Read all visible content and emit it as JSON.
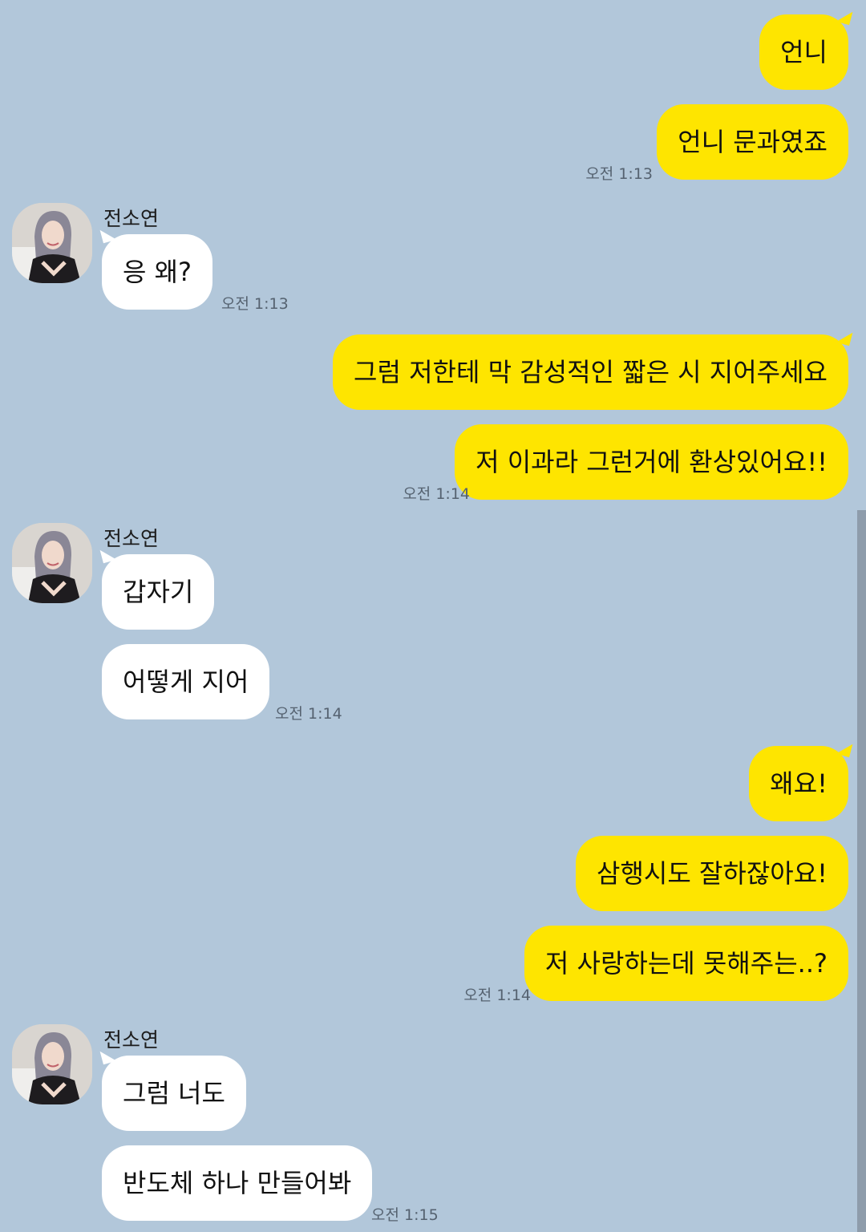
{
  "theme": {
    "background": "#b2c7da",
    "my_bubble": "#fee500",
    "their_bubble": "#ffffff"
  },
  "contact": {
    "name": "전소연",
    "avatar_icon": "profile-photo"
  },
  "groups": [
    {
      "sender": "me",
      "messages": [
        "언니",
        "언니 문과였죠"
      ],
      "time": "오전 1:13"
    },
    {
      "sender": "전소연",
      "messages": [
        "응 왜?"
      ],
      "time": "오전 1:13"
    },
    {
      "sender": "me",
      "messages": [
        "그럼 저한테 막 감성적인 짧은 시 지어주세요",
        "저 이과라 그런거에 환상있어요!!"
      ],
      "time": "오전 1:14"
    },
    {
      "sender": "전소연",
      "messages": [
        "갑자기",
        "어떻게 지어"
      ],
      "time": "오전 1:14"
    },
    {
      "sender": "me",
      "messages": [
        "왜요!",
        "삼행시도 잘하잖아요!",
        "저 사랑하는데 못해주는..?"
      ],
      "time": "오전 1:14"
    },
    {
      "sender": "전소연",
      "messages": [
        "그럼 너도",
        "반도체 하나 만들어봐"
      ],
      "time": "오전 1:15"
    }
  ]
}
